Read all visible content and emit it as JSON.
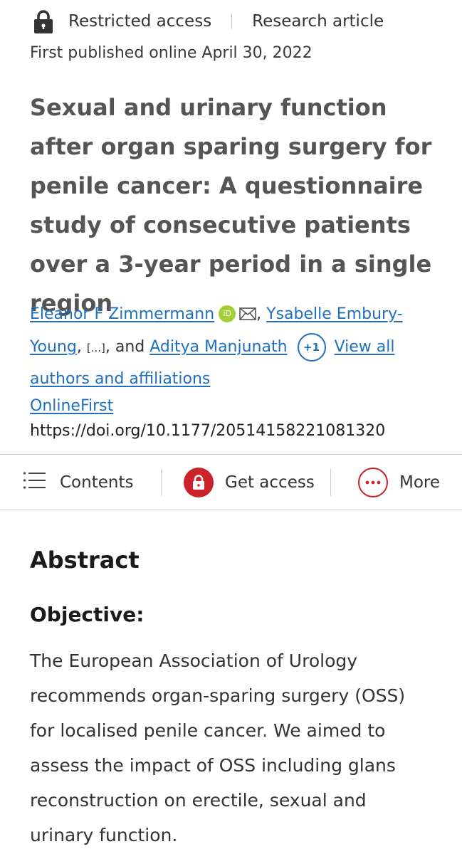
{
  "header": {
    "access_label": "Restricted access",
    "article_type": "Research article",
    "published": "First published online April 30, 2022"
  },
  "article": {
    "title": "Sexual and urinary function after organ sparing surgery for penile cancer: A questionnaire study of consecutive patients over a 3-year period in a single region"
  },
  "authors": {
    "first": "Eleanor F Zimmermann",
    "orcid_label": "iD",
    "second": "Ysabelle Embury-Young",
    "ellipsis": "[...]",
    "joiner": "and",
    "last": "Aditya Manjunath",
    "more_count": "+1",
    "view_all": "View all authors and affiliations"
  },
  "publication": {
    "status": "OnlineFirst",
    "doi": "https://doi.org/10.1177/20514158221081320"
  },
  "toolbar": {
    "contents": "Contents",
    "get_access": "Get access",
    "more": "More"
  },
  "abstract": {
    "heading": "Abstract",
    "section_heading": "Objective:",
    "body": "The European Association of Urology recommends organ-sparing surgery (OSS) for localised penile cancer. We aimed to assess the impact of OSS including glans reconstruction on erectile, sexual and urinary function."
  },
  "colors": {
    "link": "#1f6fbf",
    "accent_red": "#cc2229",
    "orcid_green": "#a6ce39",
    "title_gray": "#555555"
  },
  "icons": [
    "lock-icon",
    "orcid-icon",
    "mail-icon",
    "contents-list-icon",
    "lock-icon",
    "more-dots-icon"
  ]
}
